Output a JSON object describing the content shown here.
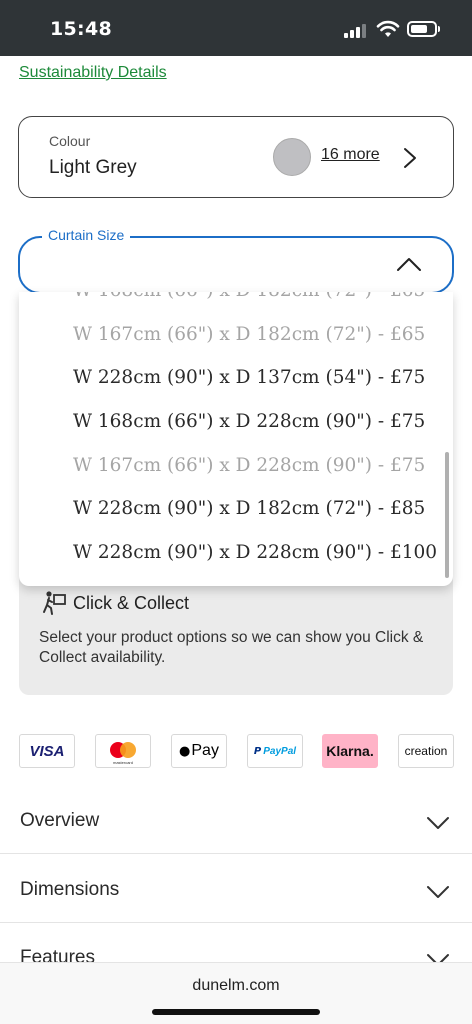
{
  "status_bar": {
    "time": "15:48"
  },
  "links": {
    "sustainability": "Sustainability Details"
  },
  "colour": {
    "label": "Colour",
    "value": "Light Grey",
    "more_label": "16 more",
    "swatch_color": "#bfbfc2"
  },
  "curtain_size": {
    "legend": "Curtain Size",
    "options": [
      {
        "text": "W 167cm (66\") x D 182cm (72\") - £65",
        "disabled": true
      },
      {
        "text": "W 228cm (90\") x D 137cm (54\") - £75",
        "disabled": false
      },
      {
        "text": "W 168cm (66\") x D 228cm (90\") - £75",
        "disabled": false
      },
      {
        "text": "W 167cm (66\") x D 228cm (90\") - £75",
        "disabled": true
      },
      {
        "text": "W 228cm (90\") x D 182cm (72\") - £85",
        "disabled": false
      },
      {
        "text": "W 228cm (90\") x D 228cm (90\") - £100",
        "disabled": false
      }
    ]
  },
  "click_collect": {
    "title": "Click & Collect",
    "description": "Select your product options so we can show you Click & Collect availability."
  },
  "payment_methods": [
    "VISA",
    "mastercard",
    "Pay",
    "PayPal",
    "Klarna.",
    "creation"
  ],
  "accordions": [
    "Overview",
    "Dimensions",
    "Features"
  ],
  "browser": {
    "url": "dunelm.com"
  },
  "colors": {
    "accent_blue": "#1c6ec7",
    "link_green": "#1d8a3a",
    "klarna_pink": "#ffb3c7",
    "status_bar": "#2f3437"
  }
}
